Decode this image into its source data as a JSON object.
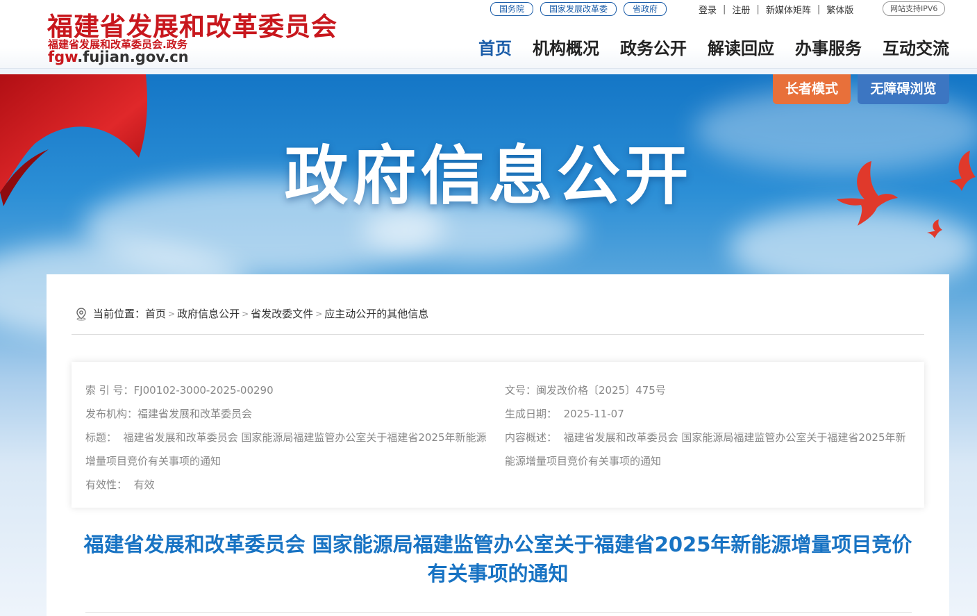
{
  "header": {
    "site_title": "福建省发展和改革委员会",
    "site_subtitle": "福建省发展和改革委员会.政务",
    "domain_prefix": "fgw",
    "domain_rest": ".fujian.gov.cn",
    "top_links": [
      "国务院",
      "国家发展改革委",
      "省政府"
    ],
    "util_links": [
      "登录",
      "注册",
      "新媒体矩阵",
      "繁体版"
    ],
    "ipv6_badge": "网站支持IPV6",
    "nav": [
      "首页",
      "机构概况",
      "政务公开",
      "解读回应",
      "办事服务",
      "互动交流"
    ],
    "nav_active_index": 0
  },
  "banner": {
    "title": "政府信息公开",
    "elder_mode": "长者模式",
    "accessible_mode": "无障碍浏览"
  },
  "breadcrumb": {
    "label": "当前位置：",
    "items": [
      "首页",
      "政府信息公开",
      "省发改委文件",
      "应主动公开的其他信息"
    ],
    "separator": ">"
  },
  "meta": {
    "index_label": "索 引 号：",
    "index_value": "FJ00102-3000-2025-00290",
    "publisher_label": "发布机构：",
    "publisher_value": "福建省发展和改革委员会",
    "title_label": "标题：",
    "title_value": "福建省发展和改革委员会 国家能源局福建监管办公室关于福建省2025年新能源增量项目竞价有关事项的通知",
    "validity_label": "有效性：",
    "validity_value": "有效",
    "doc_no_label": "文号：",
    "doc_no_value": "闽发改价格〔2025〕475号",
    "date_label": "生成日期：",
    "date_value": "2025-11-07",
    "summary_label": "内容概述：",
    "summary_value": "福建省发展和改革委员会 国家能源局福建监管办公室关于福建省2025年新能源增量项目竞价有关事项的通知"
  },
  "document": {
    "title": "福建省发展和改革委员会 国家能源局福建监管办公室关于福建省2025年新能源增量项目竞价有关事项的通知"
  },
  "colors": {
    "brand_red": "#c8171d",
    "brand_blue": "#1a5ca8",
    "title_blue": "#1873c3",
    "elder_orange": "#e8703a",
    "access_blue": "#3c76c2"
  }
}
